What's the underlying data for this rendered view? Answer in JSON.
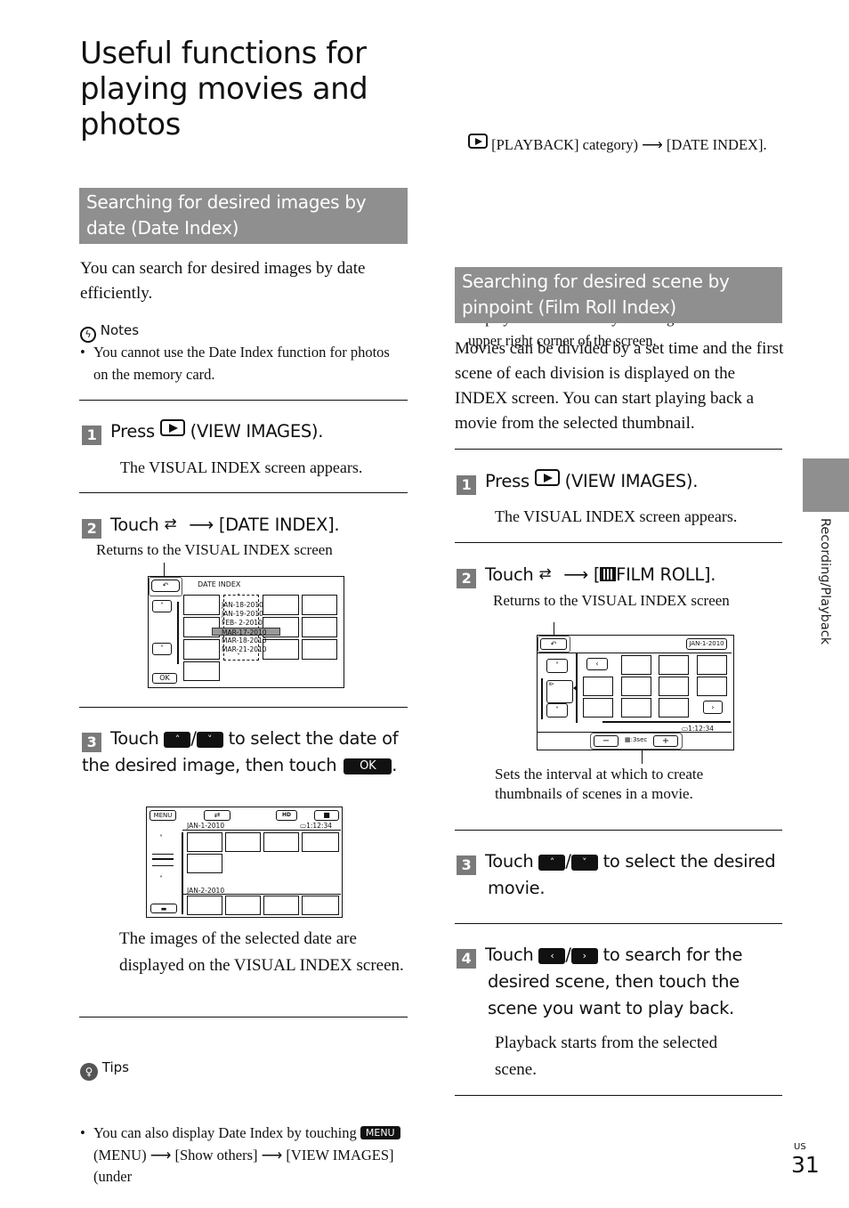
{
  "page": {
    "title": "Useful functions for playing movies and photos",
    "side_tab_label": "Recording/Playback",
    "page_region": "US",
    "page_number": "31"
  },
  "date_index_section": {
    "heading": "Searching for desired images by date (Date Index)",
    "intro": "You can search for desired images by date efficiently.",
    "notes_label": "Notes",
    "notes": [
      "You cannot use the Date Index function for photos on the memory card."
    ],
    "steps": [
      {
        "num": "1",
        "text_before": "Press",
        "text_after": "(VIEW IMAGES).",
        "result": "The VISUAL INDEX screen appears."
      },
      {
        "num": "2",
        "text_before": "Touch",
        "text_after": "[DATE INDEX].",
        "arrow": "⟶",
        "callout": "Returns to the VISUAL INDEX screen"
      },
      {
        "num": "3",
        "text_before": "Touch",
        "separator": "/",
        "text_after": "to select the date of the desired image, then touch",
        "ok_label": "OK",
        "end": ".",
        "result": "The images of the selected date are displayed on the VISUAL INDEX screen."
      }
    ],
    "screen_date_index": {
      "title": "DATE INDEX",
      "ok_label": "OK",
      "dates": [
        "JAN-18-2010",
        "JAN-19-2010",
        "FEB- 2-2010",
        "MAR-17-2010",
        "MAR-18-2010",
        "MAR-21-2010"
      ],
      "selected_date": "MAR-17-2010"
    },
    "screen_visual_index": {
      "menu_label": "MENU",
      "hd_label": "HD",
      "date1": "JAN-1-2010",
      "date2": "JAN-2-2010",
      "duration": "1:12:34"
    },
    "tips_label": "Tips",
    "tips": [
      {
        "before": "You can also display Date Index by touching",
        "menu_key": "MENU",
        "path": "(MENU) ⟶ [Show others] ⟶ [VIEW IMAGES] (under",
        "path_after": "[PLAYBACK] category) ⟶ [DATE INDEX]."
      },
      {
        "text": "On the Film Roll Index/Face Index screen, you can display the Date Index by touching the date in the upper right corner of the screen."
      }
    ]
  },
  "film_roll_section": {
    "heading": "Searching for desired scene by pinpoint (Film Roll Index)",
    "intro": "Movies can be divided by a set time and the first scene of each division is displayed on the INDEX screen. You can start playing back a movie from the selected thumbnail.",
    "steps": [
      {
        "num": "1",
        "text_before": "Press",
        "text_after": "(VIEW IMAGES).",
        "result": "The VISUAL INDEX screen appears."
      },
      {
        "num": "2",
        "text_before": "Touch",
        "arrow": "⟶",
        "text_after": "[",
        "film_label": "FILM ROLL].",
        "callout": "Returns to the VISUAL INDEX screen"
      },
      {
        "num": "3",
        "text_before": "Touch",
        "separator": "/",
        "text_after": "to select the desired movie."
      },
      {
        "num": "4",
        "text_before": "Touch",
        "separator": "/",
        "text_after": "to search for the desired scene, then touch the scene you want to play back.",
        "result": "Playback starts from the selected scene."
      }
    ],
    "screen_film_roll": {
      "date_button": "JAN-1-2010",
      "duration": "1:12:34",
      "interval": ":3sec",
      "minus": "−",
      "plus": "+"
    },
    "interval_callout": "Sets the interval at which to create thumbnails of scenes in a movie."
  }
}
